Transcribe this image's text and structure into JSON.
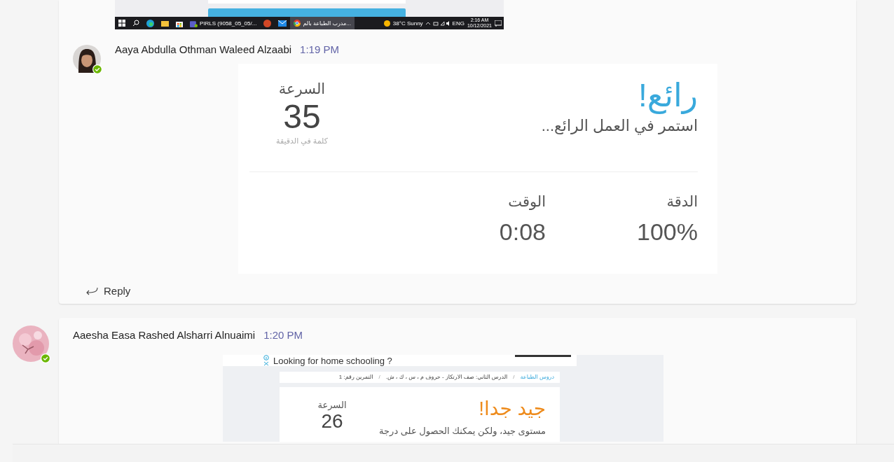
{
  "previous_attachment": {
    "kind": "screenshot",
    "taskbar": {
      "pinned": [
        {
          "kind": "start"
        },
        {
          "kind": "search"
        },
        {
          "kind": "edge"
        },
        {
          "kind": "folder"
        },
        {
          "kind": "store"
        }
      ],
      "chat_window": {
        "label": "PIRLS (9058_05_05/..."
      },
      "more_pinned": [
        {
          "kind": "powerpoint"
        },
        {
          "kind": "mail"
        }
      ],
      "browser_window": {
        "label": "مدرب الطباعة بالم...",
        "selected": true
      },
      "weather": "38°C  Sunny",
      "language": "ENG",
      "time": "2:16 AM",
      "date": "10/12/2021"
    }
  },
  "messages": [
    {
      "kind": "continued",
      "author": "Aaya Abdulla Othman Waleed Alzaabi",
      "time": "1:19 PM",
      "online": true,
      "attachment": {
        "kind": "result",
        "headline": "رائع!",
        "subtitle": "استمر في العمل الرائع...",
        "speed_label": "السرعة",
        "speed": "35",
        "speed_unit": "كلمة في الدقيقة",
        "accuracy_label": "الدقة",
        "accuracy": "100%",
        "time_label": "الوقت",
        "time": "0:08"
      },
      "reply": "Reply"
    },
    {
      "kind": "new",
      "author": "Aaesha Easa Rashed Alsharri Alnuaimi",
      "time": "1:20 PM",
      "online": true,
      "attachment": {
        "kind": "page",
        "ad": "Looking for home schooling ?",
        "breadcrumb": [
          "دروس الطباعة",
          "/",
          "الدرس الثاني: صف الارتكاز - حروف م ، س ، ك ، ش.",
          "/",
          "التمرين رقم: 1"
        ],
        "headline": "جيد جدا!",
        "subtitle": "مستوى جيد، ولكن يمكنك الحصول على درجة",
        "speed_label": "السرعة",
        "speed": "26"
      }
    }
  ]
}
